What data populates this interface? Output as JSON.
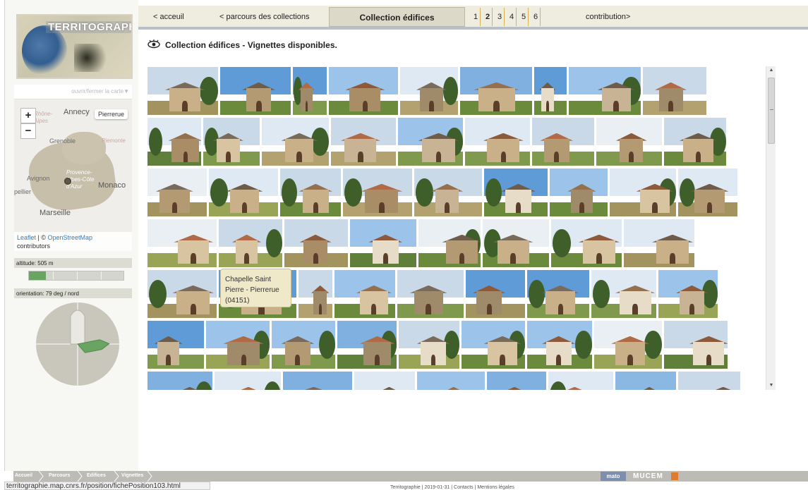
{
  "nav": {
    "home": "< acceuil",
    "collections": "< parcours des collections",
    "current": "Collection édifices",
    "pages": [
      "1",
      "2",
      "3",
      "4",
      "5",
      "6"
    ],
    "active_page": "2",
    "contribution": "contribution>"
  },
  "sidebar": {
    "logo_text": "TERRITOGRAPHIE",
    "map_toggle": "ouvrir/fermer la carte▼",
    "map": {
      "zoom_in": "+",
      "zoom_out": "−",
      "marker_label": "Pierrerue",
      "places": {
        "annecy": "Annecy",
        "grenoble": "Grenoble",
        "avignon": "Avignon",
        "region": "Provence-\nAlpes-Côte\nd'Azur",
        "monaco": "Monaco",
        "marseille": "Marseille",
        "piemonte": "Piemonte",
        "pellier": "pellier",
        "rhone": "Rhône-\nAlpes"
      },
      "attribution_leaflet": "Leaflet",
      "attribution_sep": " | © ",
      "attribution_osm": "OpenStreetMap",
      "attribution_rest": "contributors"
    },
    "altitude_label": "altitude: 505 m",
    "altitude_fraction": 0.18,
    "orientation_label": "orientation: 79 deg / nord",
    "orientation_deg": 79
  },
  "heading": "Collection édifices - Vignettes disponibles.",
  "tooltip": "Chapelle Saint Pierre - Pierrerue (04151)",
  "footer": {
    "breadcrumbs": [
      "Accueil",
      "Parcours",
      "Edifices",
      "Vignettes"
    ],
    "partner_mato": "mato",
    "partner_mucem": "MUCEM",
    "info": "Territographie | 2019-01-31 | Contacts | Mentions légales"
  },
  "status_url": "territographie.map.cnrs.fr/position/fichePosition103.html",
  "icons": {
    "eye": "eye-icon",
    "scroll_up": "scroll-up-arrow-icon",
    "scroll_down": "scroll-down-arrow-icon"
  },
  "colors": {
    "nav_bg": "#efece0",
    "nav_current_bg": "#ddd9c8",
    "map_region": "#c7bfa9",
    "altitude_fill": "#6aa463",
    "compass_arrow": "#6aa463",
    "tooltip_bg": "#efe8c9"
  }
}
